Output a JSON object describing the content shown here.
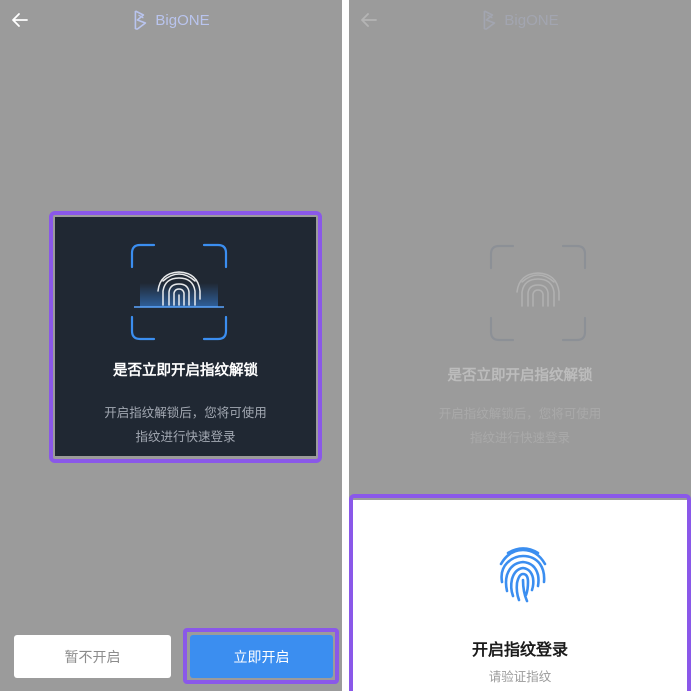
{
  "left": {
    "header": {
      "logo_text": "BigONE"
    },
    "dialog": {
      "title": "是否立即开启指纹解锁",
      "description_line1": "开启指纹解锁后，您将可使用",
      "description_line2": "指纹进行快速登录"
    },
    "buttons": {
      "later_label": "暂不开启",
      "enable_label": "立即开启"
    }
  },
  "right": {
    "header": {
      "logo_text": "BigONE"
    },
    "background_dialog": {
      "title": "是否立即开启指纹解锁",
      "description_line1": "开启指纹解锁后，您将可使用",
      "description_line2": "指纹进行快速登录"
    },
    "sheet": {
      "title": "开启指纹登录",
      "subtitle": "请验证指纹"
    }
  },
  "colors": {
    "accent_blue": "#3b8ef0",
    "highlight_purple": "#8a58e9",
    "dialog_bg": "#202833",
    "overlay_gray": "#9b9b9b"
  },
  "icons": {
    "back": "arrow-left-icon",
    "logo": "bigone-logo-icon",
    "fingerprint": "fingerprint-icon"
  }
}
